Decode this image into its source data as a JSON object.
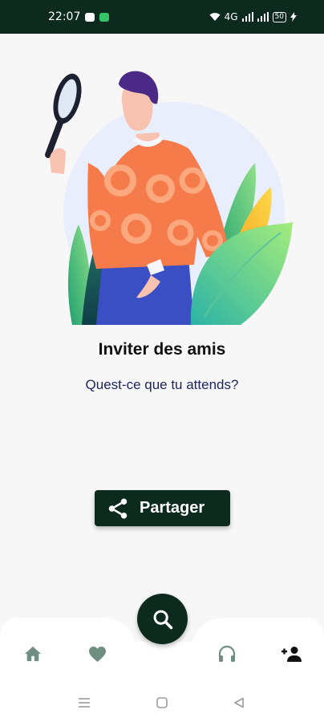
{
  "status_bar": {
    "time": "22:07",
    "network": "4G",
    "battery": "50"
  },
  "invite": {
    "title": "Inviter des amis",
    "subtitle": "Quest-ce que tu attends?"
  },
  "share_button": {
    "label": "Partager",
    "icon": "share-icon"
  },
  "bottom_nav": {
    "items": [
      {
        "icon": "home-icon"
      },
      {
        "icon": "heart-icon"
      },
      {
        "icon": "search-icon"
      },
      {
        "icon": "headphones-icon"
      },
      {
        "icon": "add-person-icon"
      }
    ]
  },
  "colors": {
    "primary": "#0d2a1f",
    "nav_icon_inactive": "#6f8f83",
    "subtitle": "#1f2560",
    "sweater": "#f57c4a"
  }
}
